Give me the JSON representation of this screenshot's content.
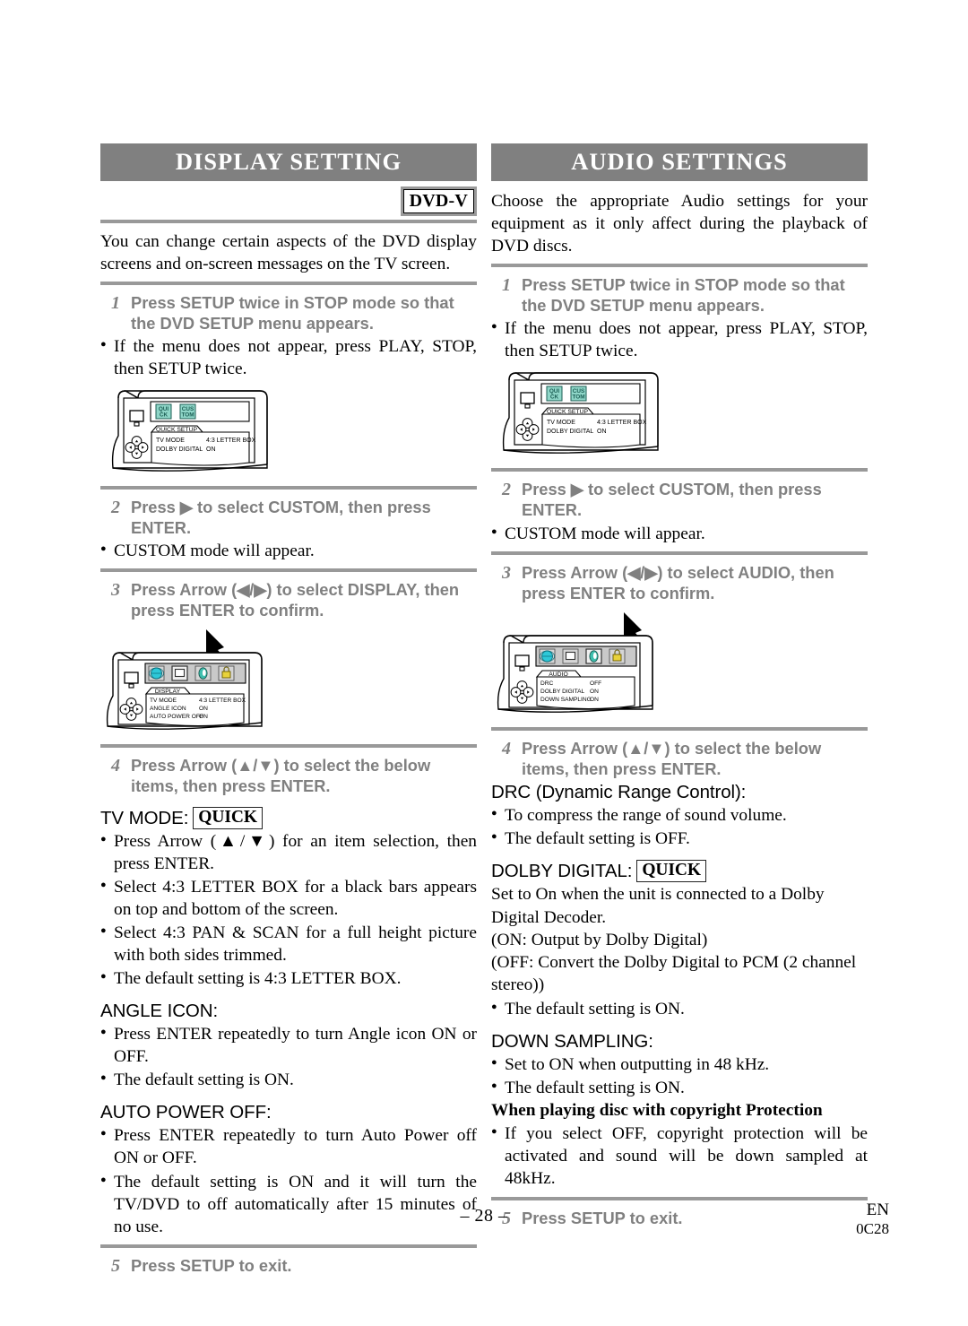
{
  "colors": {
    "header_bar_bg": "#808080",
    "header_bar_text": "#ffffff",
    "rule": "#999999",
    "step_text": "#808080",
    "icon_globe": "#2ec8d8",
    "icon_display": "#d8d8d8",
    "icon_audio": "#3fbfae",
    "icon_lock": "#e8d23a",
    "icon_tile_bg": "#8fd6c8"
  },
  "left": {
    "header": "DISPLAY SETTING",
    "badge": "DVD-V",
    "intro": "You can change certain aspects of the DVD display screens and on-screen messages on the TV screen.",
    "step1": {
      "num": "1",
      "text": "Press SETUP twice in STOP mode so that the DVD SETUP menu appears."
    },
    "step1_bullet": "If the menu does not appear, press PLAY, STOP, then SETUP twice.",
    "illus1": {
      "name": "quick-setup-menu-illustration",
      "tab": "QUICK SETUP",
      "icons": [
        {
          "line1": "QUI",
          "line2": "CK"
        },
        {
          "line1": "CUS",
          "line2": "TOM"
        }
      ],
      "rows": [
        {
          "label": "TV MODE",
          "value": "4:3 LETTER BOX"
        },
        {
          "label": "DOLBY DIGITAL",
          "value": "ON"
        }
      ]
    },
    "step2": {
      "num": "2",
      "text": "Press ▶ to select CUSTOM, then press ENTER."
    },
    "step2_bullet": "CUSTOM mode will appear.",
    "step3": {
      "num": "3",
      "text": "Press Arrow (◀/▶) to select DISPLAY, then press ENTER to confirm."
    },
    "illus2": {
      "name": "display-menu-illustration",
      "tab": "DISPLAY",
      "icons": [
        "globe-icon",
        "display-icon",
        "audio-icon",
        "lock-icon"
      ],
      "selected_icon_index": 1,
      "arrow": "pointer-arrow",
      "rows": [
        {
          "label": "TV MODE",
          "value": "4:3 LETTER BOX"
        },
        {
          "label": "ANGLE ICON",
          "value": "ON"
        },
        {
          "label": "AUTO POWER OFF",
          "value": "ON"
        }
      ]
    },
    "step4": {
      "num": "4",
      "text": "Press Arrow (▲/▼) to select the below items, then press ENTER."
    },
    "tv_mode": {
      "label": "TV MODE:",
      "badge": "QUICK"
    },
    "tv_mode_bullets": [
      "Press Arrow (▲/▼) for an item selection, then press ENTER.",
      "Select 4:3 LETTER BOX for a black bars appears on top and bottom of the screen.",
      "Select 4:3 PAN & SCAN for a full height picture with both sides trimmed.",
      "The default setting is 4:3 LETTER BOX."
    ],
    "angle_icon": {
      "label": "ANGLE ICON:"
    },
    "angle_icon_bullets": [
      "Press ENTER repeatedly to turn Angle icon ON or OFF.",
      "The default setting is ON."
    ],
    "auto_power_off": {
      "label": "AUTO POWER OFF:"
    },
    "auto_power_off_bullets": [
      "Press ENTER repeatedly to turn Auto Power off ON or OFF.",
      "The default setting is ON and it will turn the TV/DVD to off automatically after 15 minutes of no use."
    ],
    "step5": {
      "num": "5",
      "text": "Press SETUP to exit."
    }
  },
  "right": {
    "header": "AUDIO SETTINGS",
    "intro": "Choose the appropriate Audio settings for your equipment as it only affect during the playback of DVD discs.",
    "step1": {
      "num": "1",
      "text": "Press SETUP twice in STOP mode so that the DVD SETUP menu appears."
    },
    "step1_bullet": "If the menu does not appear, press PLAY, STOP, then SETUP twice.",
    "illus1": {
      "name": "quick-setup-menu-illustration",
      "tab": "QUICK SETUP",
      "icons": [
        {
          "line1": "QUI",
          "line2": "CK"
        },
        {
          "line1": "CUS",
          "line2": "TOM"
        }
      ],
      "rows": [
        {
          "label": "TV MODE",
          "value": "4:3 LETTER BOX"
        },
        {
          "label": "DOLBY DIGITAL",
          "value": "ON"
        }
      ]
    },
    "step2": {
      "num": "2",
      "text": "Press ▶ to select CUSTOM, then press ENTER."
    },
    "step2_bullet": "CUSTOM mode will appear.",
    "step3": {
      "num": "3",
      "text": "Press Arrow (◀/▶) to select AUDIO, then press ENTER to confirm."
    },
    "illus2": {
      "name": "audio-menu-illustration",
      "tab": "AUDIO",
      "icons": [
        "globe-icon",
        "display-icon",
        "audio-icon",
        "lock-icon"
      ],
      "selected_icon_index": 2,
      "arrow": "pointer-arrow",
      "rows": [
        {
          "label": "DRC",
          "value": "OFF"
        },
        {
          "label": "DOLBY DIGITAL",
          "value": "ON"
        },
        {
          "label": "DOWN SAMPLING",
          "value": "ON"
        }
      ]
    },
    "step4": {
      "num": "4",
      "text": "Press Arrow (▲/▼) to select the below items, then press ENTER."
    },
    "drc": {
      "label": "DRC (Dynamic Range Control):"
    },
    "drc_bullets": [
      "To compress the range of sound volume.",
      "The default setting is OFF."
    ],
    "dolby": {
      "label": "DOLBY DIGITAL:",
      "badge": "QUICK"
    },
    "dolby_lines": [
      "Set to On when the unit is connected to a Dolby Digital Decoder.",
      "(ON: Output by Dolby Digital)",
      "(OFF: Convert the Dolby Digital to PCM (2 channel stereo))"
    ],
    "dolby_bullets": [
      "The default setting is ON."
    ],
    "down_sampling": {
      "label": "DOWN SAMPLING:"
    },
    "down_sampling_bullets": [
      "Set to ON when outputting in 48 kHz.",
      "The default setting is ON."
    ],
    "copyright_heading": "When playing disc with copyright Protection",
    "copyright_bullets": [
      "If you select OFF, copyright protection will be activated and sound will be down sampled at 48kHz."
    ],
    "step5": {
      "num": "5",
      "text": "Press SETUP to exit."
    }
  },
  "footer": {
    "page": "– 28 –",
    "lang": "EN",
    "code": "0C28"
  }
}
